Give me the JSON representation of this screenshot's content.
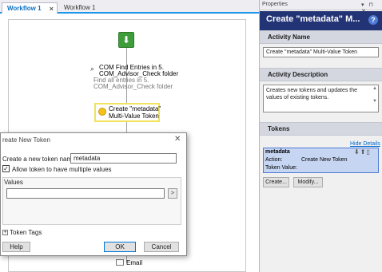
{
  "tabs": [
    {
      "label": "Workflow 1",
      "active": true
    },
    {
      "label": "Workflow 1",
      "active": false
    }
  ],
  "tab_controls": "▾ ⊓ ▸",
  "workflow": {
    "find_activity": {
      "title_line1": "COM Find Entries in 5.",
      "title_line2": "COM_Advisor_Check folder",
      "desc_line1": "Find all entries in 5.",
      "desc_line2": "COM_Advisor_Check folder"
    },
    "create_activity": {
      "line1": "Create \"metadata\"",
      "line2": "Multi-Value Token"
    },
    "email_activity": {
      "label": "Email"
    }
  },
  "dialog": {
    "title": "reate New Token",
    "name_label": "Create a new token named:",
    "name_value": "metadata",
    "multi_label": "Allow token to have multiple values",
    "multi_checked": "✓",
    "values_label": "Values",
    "values_value": "",
    "values_arrow": ">",
    "tags_toggle": "+",
    "tags_label": "Token Tags",
    "help_label": "Help",
    "ok_label": "OK",
    "cancel_label": "Cancel"
  },
  "properties": {
    "panel_label": "Properties",
    "panel_controls": "▾ ⊓ ✕",
    "title": "Create \"metadata\" M...",
    "activity_name_header": "Activity Name",
    "activity_name_value": "Create \"metadata\" Multi-Value Token",
    "activity_desc_header": "Activity Description",
    "activity_desc_value": "Creates new tokens and updates the values of existing tokens.",
    "tokens_header": "Tokens",
    "hide_details": "Hide Details",
    "token": {
      "name": "metadata",
      "action_key": "Action:",
      "action_value": "Create New Token",
      "value_key": "Token Value:"
    },
    "create_label": "Create...",
    "modify_label": "Modify..."
  },
  "colors": {
    "accent_blue": "#1c97ea",
    "properties_title_bg": "#233476",
    "token_card_bg": "#c6d5f2",
    "start_green": "#3e9c3a",
    "selection_yellow": "#f3e25c"
  }
}
